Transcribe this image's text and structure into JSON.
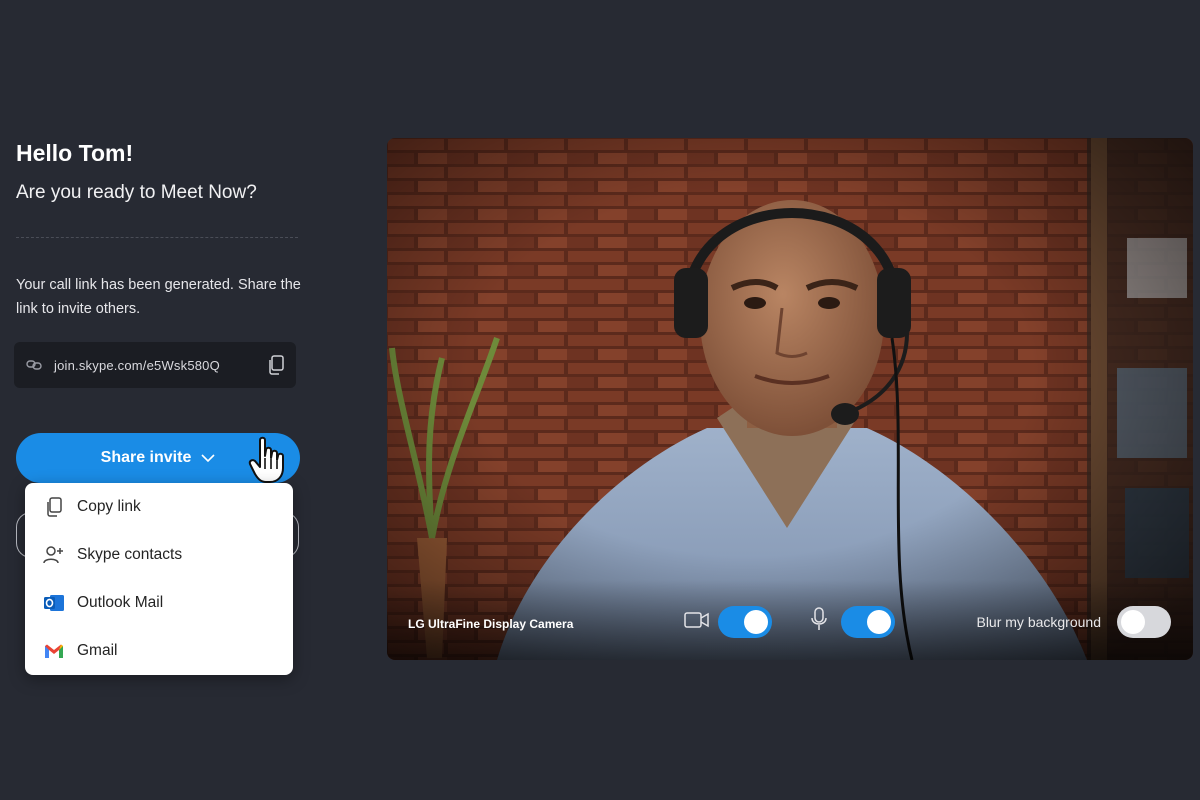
{
  "greeting": {
    "title": "Hello  Tom!",
    "subtitle": "Are you ready to Meet Now?"
  },
  "call_link": {
    "info_text": "Your call link has been generated. Share the link to invite others.",
    "url": "join.skype.com/e5Wsk580Q",
    "icons": [
      "link-icon",
      "copy-icon"
    ]
  },
  "share_button": {
    "label": "Share invite",
    "icon": "chevron-down-icon"
  },
  "share_menu": {
    "items": [
      {
        "label": "Copy link",
        "icon": "copy-icon"
      },
      {
        "label": "Skype contacts",
        "icon": "add-contact-icon"
      },
      {
        "label": "Outlook Mail",
        "icon": "outlook-icon"
      },
      {
        "label": "Gmail",
        "icon": "gmail-icon"
      }
    ]
  },
  "video": {
    "camera_name": "LG UltraFine Display Camera",
    "camera_enabled": true,
    "mic_enabled": true,
    "blur_label": "Blur my background",
    "blur_enabled": false
  },
  "colors": {
    "background": "#272a33",
    "accent": "#1a8ce6",
    "link_box": "#1b1d23",
    "menu_bg": "#ffffff"
  }
}
